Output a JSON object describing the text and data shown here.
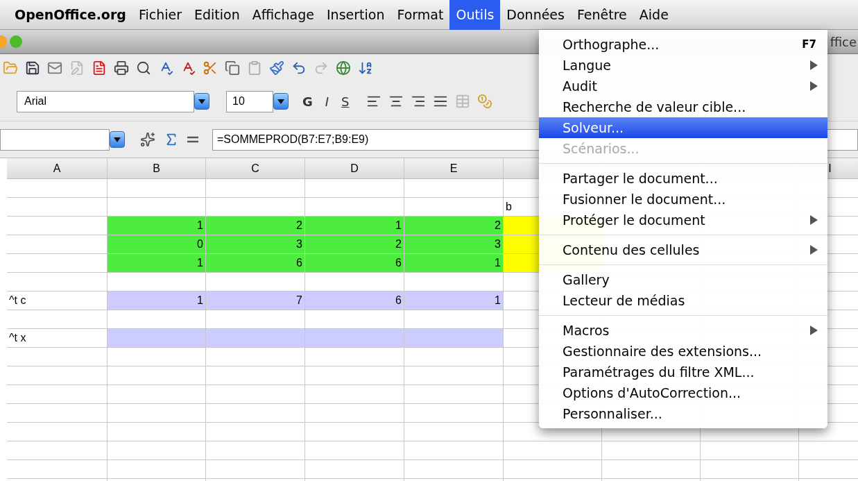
{
  "menubar": [
    {
      "label": "OpenOffice.org",
      "kind": "app",
      "selected": false
    },
    {
      "label": "Fichier",
      "kind": "menu",
      "selected": false
    },
    {
      "label": "Edition",
      "kind": "menu",
      "selected": false
    },
    {
      "label": "Affichage",
      "kind": "menu",
      "selected": false
    },
    {
      "label": "Insertion",
      "kind": "menu",
      "selected": false
    },
    {
      "label": "Format",
      "kind": "menu",
      "selected": false
    },
    {
      "label": "Outils",
      "kind": "menu",
      "selected": true
    },
    {
      "label": "Données",
      "kind": "menu",
      "selected": false
    },
    {
      "label": "Fenêtre",
      "kind": "menu",
      "selected": false
    },
    {
      "label": "Aide",
      "kind": "menu",
      "selected": false
    }
  ],
  "window": {
    "title": "ffice"
  },
  "format_bar": {
    "font": "Arial",
    "size": "10",
    "bold": "G",
    "italic": "I",
    "underline": "S"
  },
  "formula_bar": {
    "formula": "=SOMMEPROD(B7:E7;B9:E9)"
  },
  "sheet": {
    "column_headers": [
      "A",
      "B",
      "C",
      "D",
      "E"
    ],
    "far_column_header": "I",
    "rows": [
      [
        {},
        {},
        {},
        {},
        {},
        {}
      ],
      [
        {},
        {},
        {},
        {},
        {},
        {
          "text": "b",
          "kind": "text"
        }
      ],
      [
        {},
        {
          "text": "1",
          "kind": "number",
          "color": "#4ded3f"
        },
        {
          "text": "2",
          "kind": "number",
          "color": "#4ded3f"
        },
        {
          "text": "1",
          "kind": "number",
          "color": "#4ded3f"
        },
        {
          "text": "2",
          "kind": "number",
          "color": "#4ded3f"
        },
        {
          "color": "#ffff00"
        }
      ],
      [
        {},
        {
          "text": "0",
          "kind": "number",
          "color": "#4ded3f"
        },
        {
          "text": "3",
          "kind": "number",
          "color": "#4ded3f"
        },
        {
          "text": "2",
          "kind": "number",
          "color": "#4ded3f"
        },
        {
          "text": "3",
          "kind": "number",
          "color": "#4ded3f"
        },
        {
          "color": "#ffff00"
        }
      ],
      [
        {},
        {
          "text": "1",
          "kind": "number",
          "color": "#4ded3f"
        },
        {
          "text": "6",
          "kind": "number",
          "color": "#4ded3f"
        },
        {
          "text": "6",
          "kind": "number",
          "color": "#4ded3f"
        },
        {
          "text": "1",
          "kind": "number",
          "color": "#4ded3f"
        },
        {
          "color": "#ffff00"
        }
      ],
      [
        {},
        {},
        {},
        {},
        {},
        {}
      ],
      [
        {
          "text": "^t c",
          "kind": "text"
        },
        {
          "text": "1",
          "kind": "number",
          "color": "#ccccff"
        },
        {
          "text": "7",
          "kind": "number",
          "color": "#ccccff"
        },
        {
          "text": "6",
          "kind": "number",
          "color": "#ccccff"
        },
        {
          "text": "1",
          "kind": "number",
          "color": "#ccccff"
        },
        {}
      ],
      [
        {},
        {},
        {},
        {},
        {},
        {}
      ],
      [
        {
          "text": "^t x",
          "kind": "text"
        },
        {
          "color": "#ccccff"
        },
        {
          "color": "#ccccff"
        },
        {
          "color": "#ccccff"
        },
        {
          "color": "#ccccff"
        },
        {}
      ],
      [
        {},
        {},
        {},
        {},
        {},
        {}
      ],
      [
        {},
        {},
        {},
        {},
        {},
        {}
      ],
      [
        {},
        {},
        {},
        {},
        {},
        {}
      ],
      [
        {},
        {},
        {},
        {},
        {},
        {}
      ],
      [
        {},
        {},
        {},
        {},
        {},
        {}
      ],
      [
        {},
        {},
        {},
        {},
        {},
        {}
      ],
      [
        {},
        {},
        {},
        {},
        {},
        {}
      ],
      [
        {},
        {},
        {},
        {},
        {},
        {}
      ]
    ]
  },
  "dropdown": {
    "groups": [
      [
        {
          "label": "Orthographe...",
          "shortcut": "F7",
          "submenu": false,
          "selected": false,
          "disabled": false
        },
        {
          "label": "Langue",
          "submenu": true,
          "selected": false,
          "disabled": false
        },
        {
          "label": "Audit",
          "submenu": true,
          "selected": false,
          "disabled": false
        },
        {
          "label": "Recherche de valeur cible...",
          "submenu": false,
          "selected": false,
          "disabled": false
        },
        {
          "label": "Solveur...",
          "submenu": false,
          "selected": true,
          "disabled": false
        },
        {
          "label": "Scénarios...",
          "submenu": false,
          "selected": false,
          "disabled": true
        }
      ],
      [
        {
          "label": "Partager le document...",
          "submenu": false,
          "selected": false,
          "disabled": false
        },
        {
          "label": "Fusionner le document...",
          "submenu": false,
          "selected": false,
          "disabled": false
        },
        {
          "label": "Protéger le document",
          "submenu": true,
          "selected": false,
          "disabled": false
        }
      ],
      [
        {
          "label": "Contenu des cellules",
          "submenu": true,
          "selected": false,
          "disabled": false
        }
      ],
      [
        {
          "label": "Gallery",
          "submenu": false,
          "selected": false,
          "disabled": false
        },
        {
          "label": "Lecteur de médias",
          "submenu": false,
          "selected": false,
          "disabled": false
        }
      ],
      [
        {
          "label": "Macros",
          "submenu": true,
          "selected": false,
          "disabled": false
        },
        {
          "label": "Gestionnaire des extensions...",
          "submenu": false,
          "selected": false,
          "disabled": false
        },
        {
          "label": "Paramétrages du filtre XML...",
          "submenu": false,
          "selected": false,
          "disabled": false
        },
        {
          "label": "Options d'AutoCorrection...",
          "submenu": false,
          "selected": false,
          "disabled": false
        },
        {
          "label": "Personnaliser...",
          "submenu": false,
          "selected": false,
          "disabled": false
        }
      ]
    ]
  }
}
